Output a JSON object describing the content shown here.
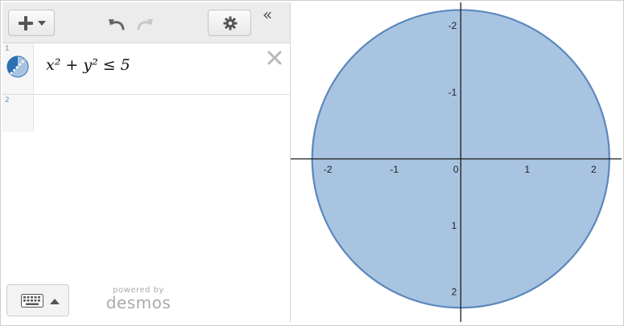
{
  "toolbar": {
    "add_icon": "plus-icon",
    "undo_icon": "undo-icon",
    "redo_icon": "redo-icon",
    "settings_icon": "gear-icon",
    "collapse_icon": "double-chevron-left-icon",
    "collapse_label": "«"
  },
  "expressions": [
    {
      "number": "1",
      "latex_display": "x² + y² ≤ 5",
      "color": "#2d70b3"
    },
    {
      "number": "2",
      "latex_display": ""
    }
  ],
  "footer": {
    "powered_by": "powered by",
    "brand": "desmos"
  },
  "graph": {
    "x_ticks": [
      "-2",
      "-1",
      "0",
      "1",
      "2"
    ],
    "y_ticks": [
      "2",
      "1",
      "-1",
      "-2"
    ],
    "fill_color": "#a9c4e0",
    "stroke_color": "#5b87bd"
  },
  "chart_data": {
    "type": "area",
    "title": "",
    "relation": "x^2 + y^2 <= 5",
    "shape": "disk",
    "center": [
      0,
      0
    ],
    "radius": 2.2360679775,
    "xlim": [
      -2.56,
      2.42
    ],
    "ylim": [
      -2.45,
      2.35
    ],
    "x_ticks": [
      -2,
      -1,
      0,
      1,
      2
    ],
    "y_ticks": [
      -2,
      -1,
      1,
      2
    ],
    "grid": false
  }
}
